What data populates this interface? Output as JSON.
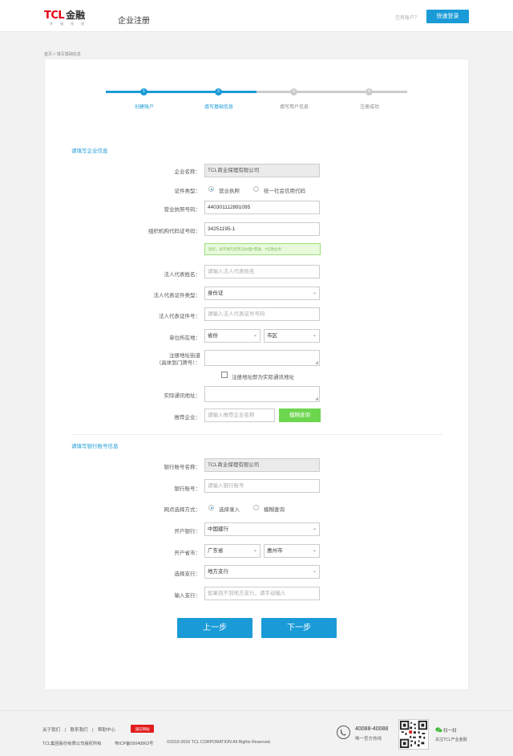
{
  "header": {
    "logo_text": "TCL",
    "logo_cn": "金融",
    "logo_sub": "幸福钱袋",
    "title": "企业注册",
    "have_account": "已有账户？",
    "login_button": "快速登录"
  },
  "breadcrumb": "首页 > 填写基础信息",
  "steps": [
    {
      "num": "1",
      "label": "创建账户",
      "state": "done"
    },
    {
      "num": "2",
      "label": "填写基础信息",
      "state": "active"
    },
    {
      "num": "3",
      "label": "填写用户信息",
      "state": "todo"
    },
    {
      "num": "4",
      "label": "注册成功",
      "state": "todo"
    }
  ],
  "colors": {
    "accent": "#1a9bd7",
    "inactive": "#cccccc",
    "green": "#6cd64f"
  },
  "company": {
    "section_title": "请填写企业信息",
    "name_label": "企业名称：",
    "name_value": "TCL商业保理有限公司",
    "cert_type_label": "证件类型：",
    "cert_options": [
      "营业执照",
      "统一社会信用代码"
    ],
    "cert_selected": "营业执照",
    "license_label": "营业执照号码：",
    "license_value": "440301112891095",
    "org_code_label": "组织机构代码证号码：",
    "org_code_value": "34251195-1",
    "tip_text": "您好，如不填写则无法办理T票通、T信融业务",
    "legal_name_label": "法人代表姓名：",
    "legal_name_placeholder": "请输入法人代表姓名",
    "legal_idtype_label": "法人代表证件类型：",
    "legal_idtype_value": "身份证",
    "legal_idno_label": "法人代表证件号：",
    "legal_idno_placeholder": "请输入法人代表证件号码",
    "location_label": "单位所在地：",
    "province_value": "省份",
    "city_value": "市区",
    "reg_addr_label_1": "注册地址街道",
    "reg_addr_label_2": "（具体到门牌号）：",
    "same_addr_text": "注册地址即为实际通讯地址",
    "actual_addr_label": "实际通讯地址：",
    "recommend_label": "推荐企业：",
    "recommend_placeholder": "请输入推荐企业名称",
    "fuzzy_search_button": "模糊查询"
  },
  "bank": {
    "section_title": "请填写银行账号信息",
    "account_name_label": "银行账号名称：",
    "account_name_value": "TCL商业保理有限公司",
    "account_no_label": "银行账号：",
    "account_no_placeholder": "请输入银行账号",
    "branch_method_label": "网点选择方式：",
    "branch_method_options": [
      "选择录入",
      "模糊查询"
    ],
    "branch_method_selected": "选择录入",
    "bank_label": "开户银行：",
    "bank_value": "中国建行",
    "province_label": "开户省市：",
    "province_value": "广东省",
    "city_value": "惠州市",
    "branch_label": "选择支行：",
    "branch_value": "地方支行",
    "input_branch_label": "输入支行：",
    "input_branch_placeholder": "如果找不到地方支行，请手动输入"
  },
  "actions": {
    "prev": "上一步",
    "next": "下一步"
  },
  "footer": {
    "links": [
      "关于我们",
      "|",
      "联系我们",
      "|",
      "帮助中心"
    ],
    "badge": "诚信网站",
    "company": "TCL集团股份有限公司版权所有",
    "icp": "粤ICP备05040863号",
    "copyright": "©2010-2016 TCL CORPORATION All Rights Reserved.",
    "hotline": "40088-40088",
    "hotline_sub": "唯一官方热线",
    "wechat_title": "扫一扫",
    "wechat_sub": "关注TCL产业金融"
  }
}
